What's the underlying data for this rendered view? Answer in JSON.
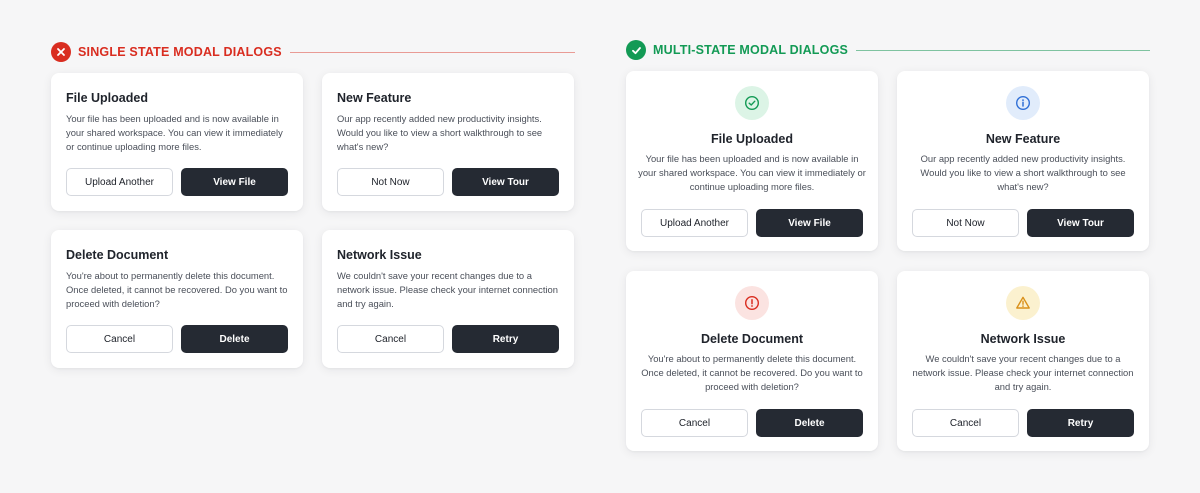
{
  "sections": {
    "single": {
      "title": "SINGLE STATE MODAL DIALOGS",
      "badge_icon": "x-icon",
      "color": "#d92d20"
    },
    "multi": {
      "title": "MULTI-STATE MODAL DIALOGS",
      "badge_icon": "check-icon",
      "color": "#139a55"
    }
  },
  "dialogs": {
    "file_uploaded": {
      "title": "File Uploaded",
      "body": "Your file has been uploaded and is now available in your shared workspace. You can view it immediately or continue uploading more files.",
      "secondary": "Upload Another",
      "primary": "View File",
      "icon": "check-circle-icon",
      "icon_color": "#139a55"
    },
    "new_feature": {
      "title": "New Feature",
      "body": "Our app recently added new productivity insights. Would you like to view a short walkthrough to see what's new?",
      "secondary": "Not Now",
      "primary": "View Tour",
      "icon": "info-icon",
      "icon_color": "#2f6fd6"
    },
    "delete_document": {
      "title": "Delete Document",
      "body": "You're about to permanently delete this document. Once deleted, it cannot be recovered. Do you want to proceed with deletion?",
      "secondary": "Cancel",
      "primary": "Delete",
      "icon": "alert-circle-icon",
      "icon_color": "#d92d20"
    },
    "network_issue": {
      "title": "Network Issue",
      "body": "We couldn't save your recent changes due to a network issue. Please check your internet connection and try again.",
      "secondary": "Cancel",
      "primary": "Retry",
      "icon": "warning-icon",
      "icon_color": "#d9901a"
    }
  }
}
